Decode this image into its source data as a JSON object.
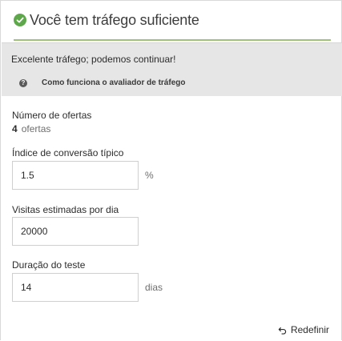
{
  "header": {
    "title": "Você tem tráfego suficiente",
    "status_color": "#5ea84b"
  },
  "banner": {
    "message": "Excelente tráfego; podemos continuar!",
    "help_link": "Como funciona o avaliador de tráfego"
  },
  "offers": {
    "label": "Número de ofertas",
    "count": "4",
    "unit": "ofertas"
  },
  "conversion": {
    "label": "Índice de conversão típico",
    "value": "1.5",
    "suffix": "%"
  },
  "visits": {
    "label": "Visitas estimadas por dia",
    "value": "20000"
  },
  "duration": {
    "label": "Duração do teste",
    "value": "14",
    "suffix": "dias"
  },
  "actions": {
    "reset_label": "Redefinir"
  }
}
